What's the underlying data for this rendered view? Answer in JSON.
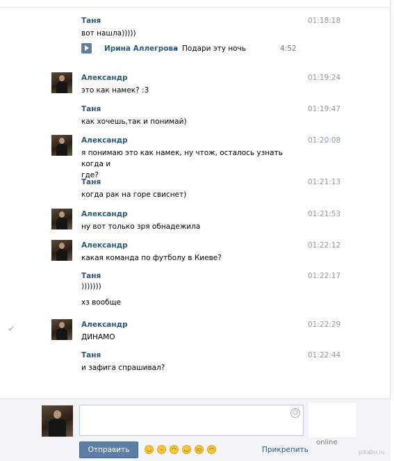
{
  "messages": [
    {
      "author": "Таня",
      "time": "01:18:18",
      "lines": [
        "вот нашла)))))"
      ],
      "avatar": false,
      "audio": {
        "artist": "Ирина Аллегрова",
        "separator": "–",
        "title": "Подари эту ночь",
        "duration": "4:52"
      }
    },
    {
      "author": "Александр",
      "time": "01:19:24",
      "lines": [
        "это как намек? :3"
      ],
      "avatar": true
    },
    {
      "author": "Таня",
      "time": "01:19:47",
      "lines": [
        "как хочешь,так и понимай)"
      ],
      "avatar": false
    },
    {
      "author": "Александр",
      "time": "01:20:08",
      "lines": [
        "я понимаю это как намек, ну чтож, осталось узнать когда и",
        "где?"
      ],
      "avatar": true
    },
    {
      "author": "Таня",
      "time": "01:21:13",
      "lines": [
        "когда рак на горе свиснет)"
      ],
      "avatar": false
    },
    {
      "author": "Александр",
      "time": "01:21:53",
      "lines": [
        "ну вот только зря обнадежила"
      ],
      "avatar": true
    },
    {
      "author": "Александр",
      "time": "01:22:12",
      "lines": [
        "какая команда по футболу в Киеве?"
      ],
      "avatar": true
    },
    {
      "author": "Таня",
      "time": "01:22:17",
      "lines": [
        ")))))))",
        "",
        "хз вообще"
      ],
      "avatar": false
    },
    {
      "author": "Александр",
      "time": "01:22:29",
      "lines": [
        "ДИНАМО"
      ],
      "avatar": true
    },
    {
      "author": "Таня",
      "time": "01:22:44",
      "lines": [
        "и зафига спрашивал?"
      ],
      "avatar": false
    }
  ],
  "composer": {
    "send_label": "Отправить",
    "attach_label": "Прикрепить",
    "status": "online",
    "input_value": ""
  },
  "watermark": "pikabu.ru"
}
